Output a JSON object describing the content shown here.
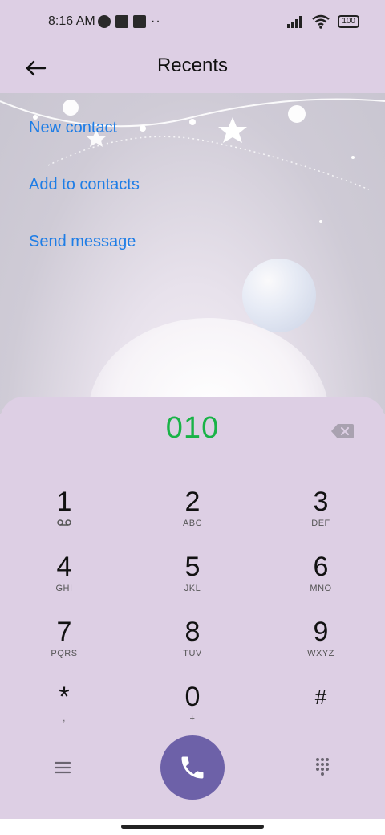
{
  "status_bar": {
    "time": "8:16 AM",
    "battery": "100"
  },
  "header": {
    "title": "Recents"
  },
  "actions": {
    "new_contact": "New contact",
    "add_to_contacts": "Add to contacts",
    "send_message": "Send message"
  },
  "dialer": {
    "number": "010",
    "keys": [
      {
        "digit": "1",
        "letters": ""
      },
      {
        "digit": "2",
        "letters": "ABC"
      },
      {
        "digit": "3",
        "letters": "DEF"
      },
      {
        "digit": "4",
        "letters": "GHI"
      },
      {
        "digit": "5",
        "letters": "JKL"
      },
      {
        "digit": "6",
        "letters": "MNO"
      },
      {
        "digit": "7",
        "letters": "PQRS"
      },
      {
        "digit": "8",
        "letters": "TUV"
      },
      {
        "digit": "9",
        "letters": "WXYZ"
      },
      {
        "digit": "*",
        "letters": ","
      },
      {
        "digit": "0",
        "letters": "+"
      },
      {
        "digit": "#",
        "letters": ""
      }
    ]
  },
  "icons": {
    "back": "back-arrow-icon",
    "backspace": "backspace-icon",
    "voicemail": "voicemail-icon",
    "menu": "menu-icon",
    "call": "phone-icon",
    "keypad": "keypad-grid-icon"
  },
  "colors": {
    "accent_link": "#1e7de6",
    "number": "#19b347",
    "call_button": "#6d61a8",
    "panel": "#ddcfe4"
  }
}
